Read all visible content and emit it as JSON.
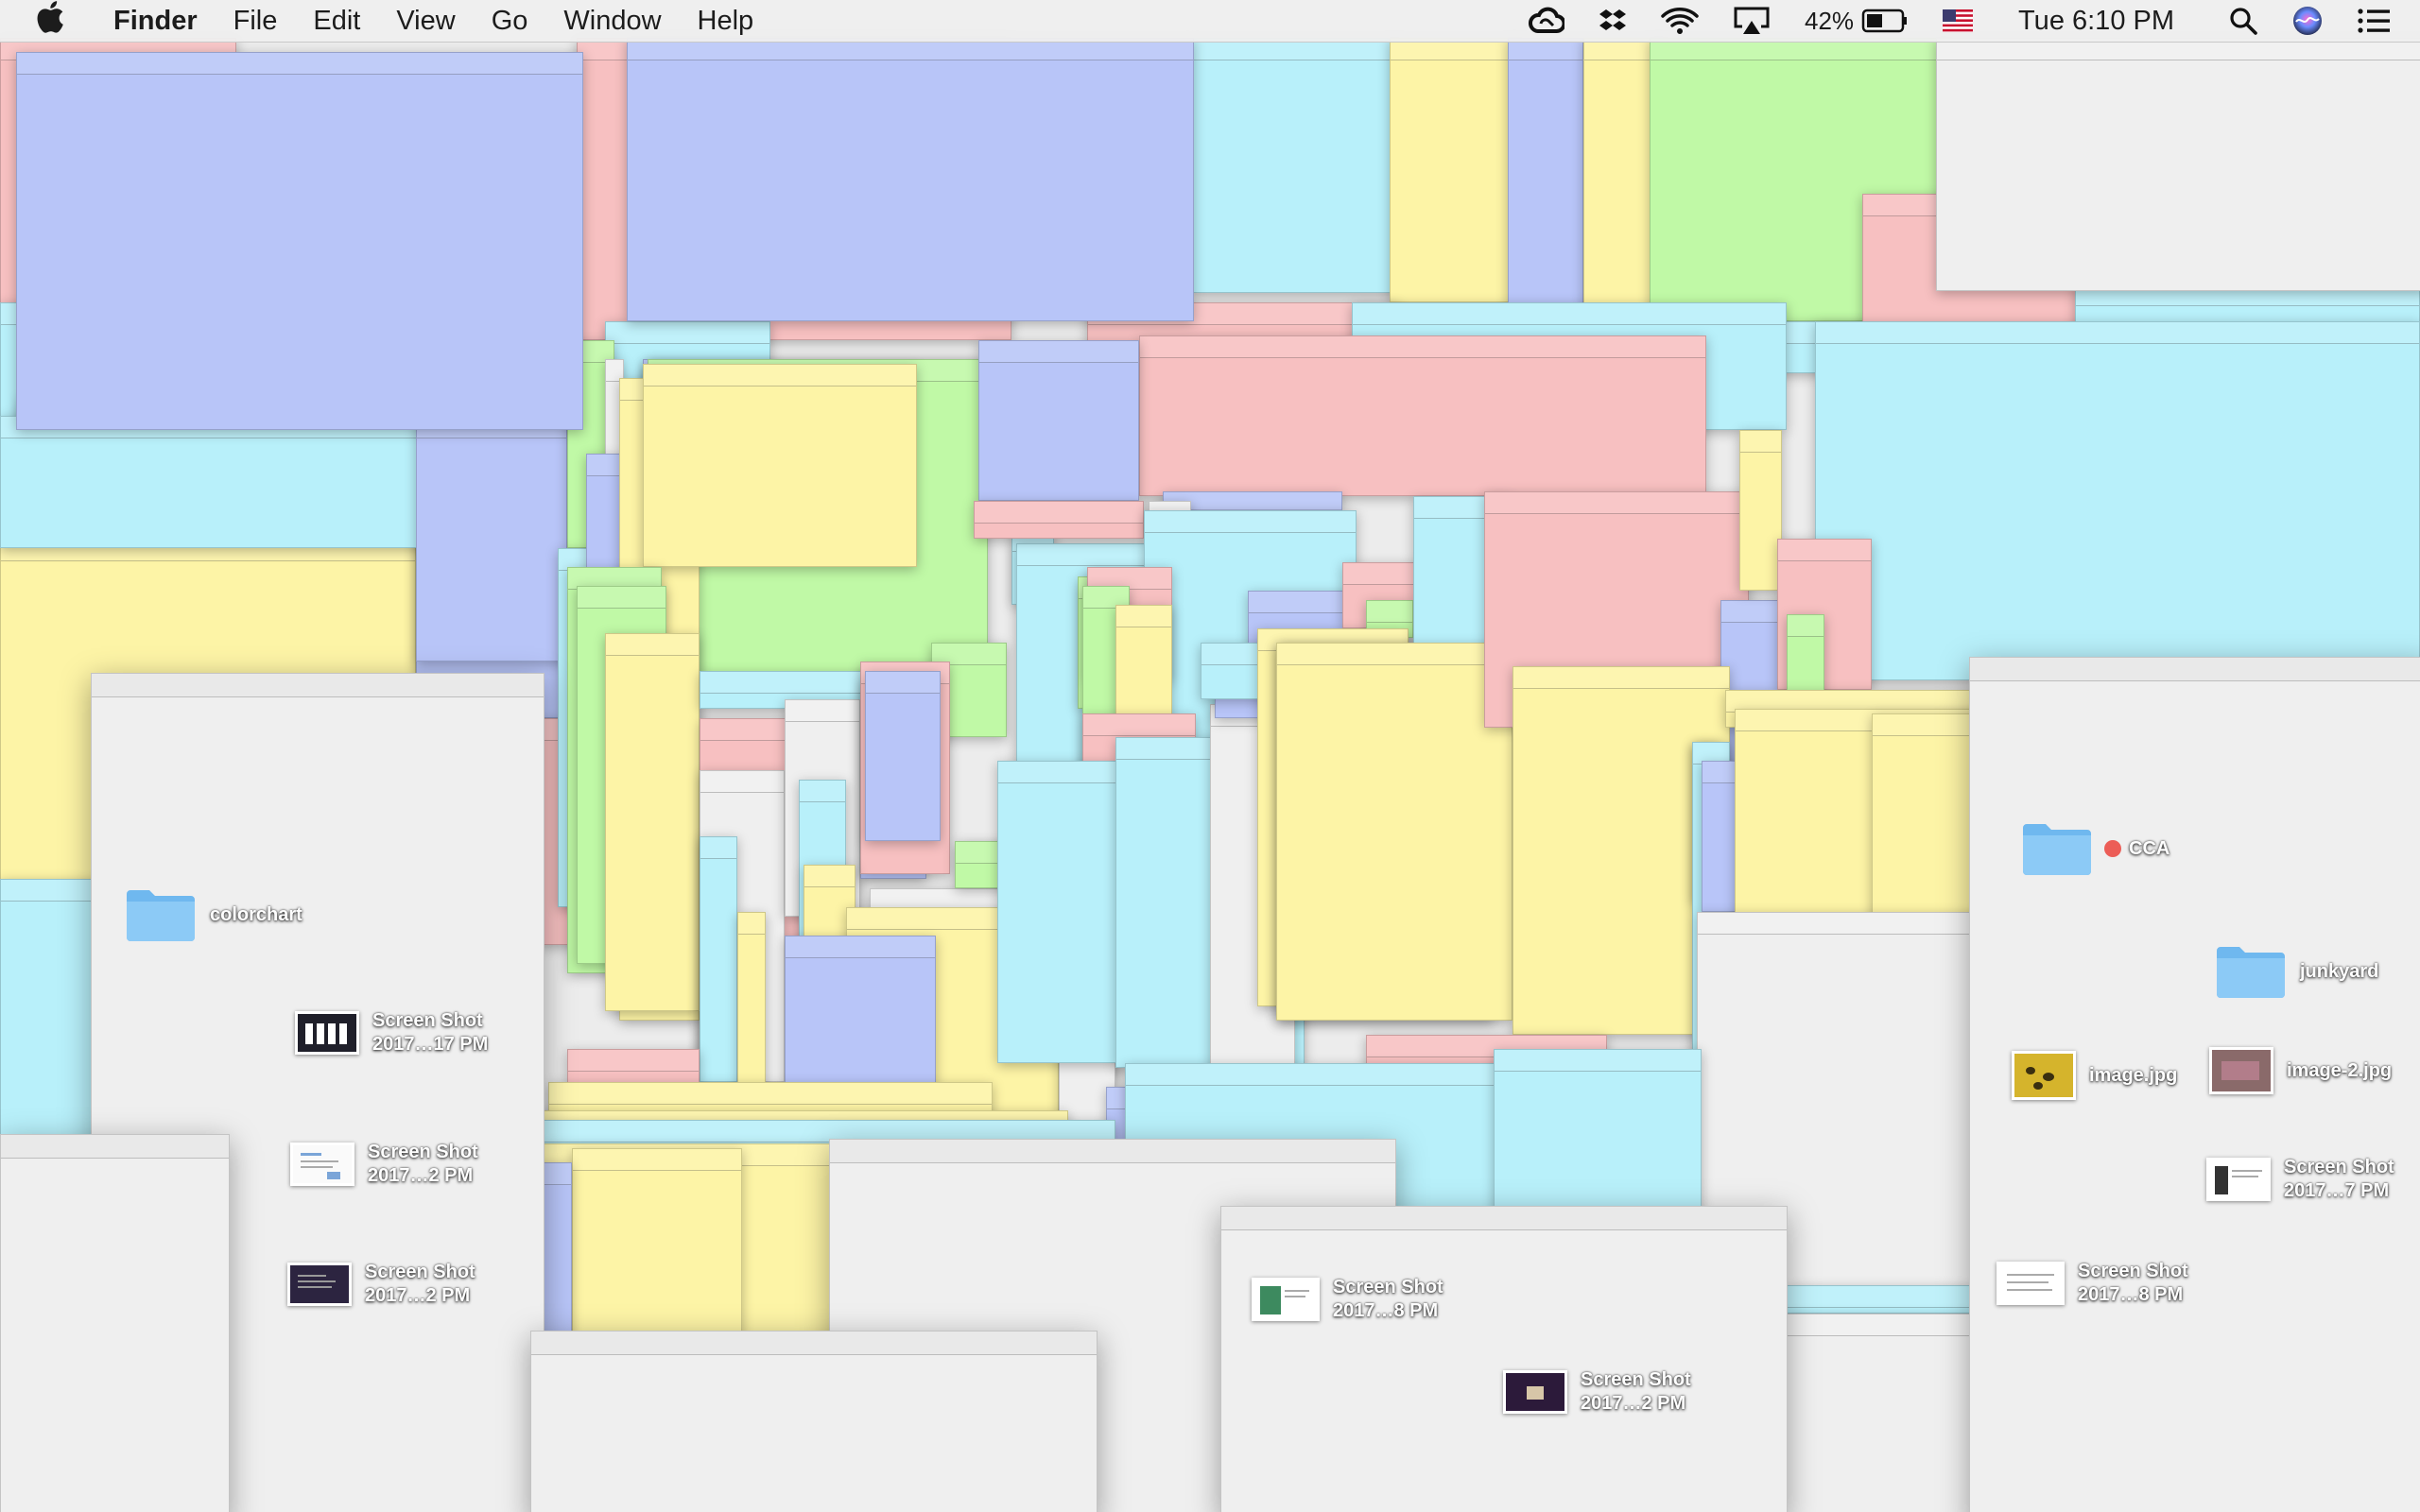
{
  "menubar": {
    "apple": "",
    "app_name": "Finder",
    "menus": [
      "File",
      "Edit",
      "View",
      "Go",
      "Window",
      "Help"
    ],
    "battery_percent": "42%",
    "clock": "Tue 6:10 PM",
    "status_icons": [
      "creative-cloud-icon",
      "dropbox-icon",
      "wifi-icon",
      "airplay-icon",
      "battery-icon",
      "us-flag-icon",
      "spotlight-icon",
      "siri-icon",
      "notification-center-icon"
    ]
  },
  "desktop": {
    "items": [
      {
        "label": "colorchart",
        "kind": "folder"
      },
      {
        "label": "Screen Shot\n2017…17 PM",
        "kind": "screenshot"
      },
      {
        "label": "Screen Shot\n2017…2 PM",
        "kind": "screenshot"
      },
      {
        "label": "Screen Shot\n2017…2 PM",
        "kind": "screenshot"
      },
      {
        "label": "CCA",
        "kind": "folder",
        "tag": "red"
      },
      {
        "label": "junkyard",
        "kind": "folder"
      },
      {
        "label": "image.jpg",
        "kind": "image"
      },
      {
        "label": "image-2.jpg",
        "kind": "image"
      },
      {
        "label": "Screen Shot\n2017…7 PM",
        "kind": "screenshot"
      },
      {
        "label": "Screen Shot\n2017…8 PM",
        "kind": "screenshot"
      },
      {
        "label": "Screen Shot\n2017…8 PM",
        "kind": "screenshot"
      },
      {
        "label": "Screen Shot\n2017…2 PM",
        "kind": "screenshot"
      }
    ]
  },
  "colors": {
    "blue": "#b8c5f8",
    "pink": "#f7c0c1",
    "cyan": "#b8f0fa",
    "yellow": "#fdf4a6",
    "green": "#c0f9a6",
    "gray": "#efefef"
  }
}
